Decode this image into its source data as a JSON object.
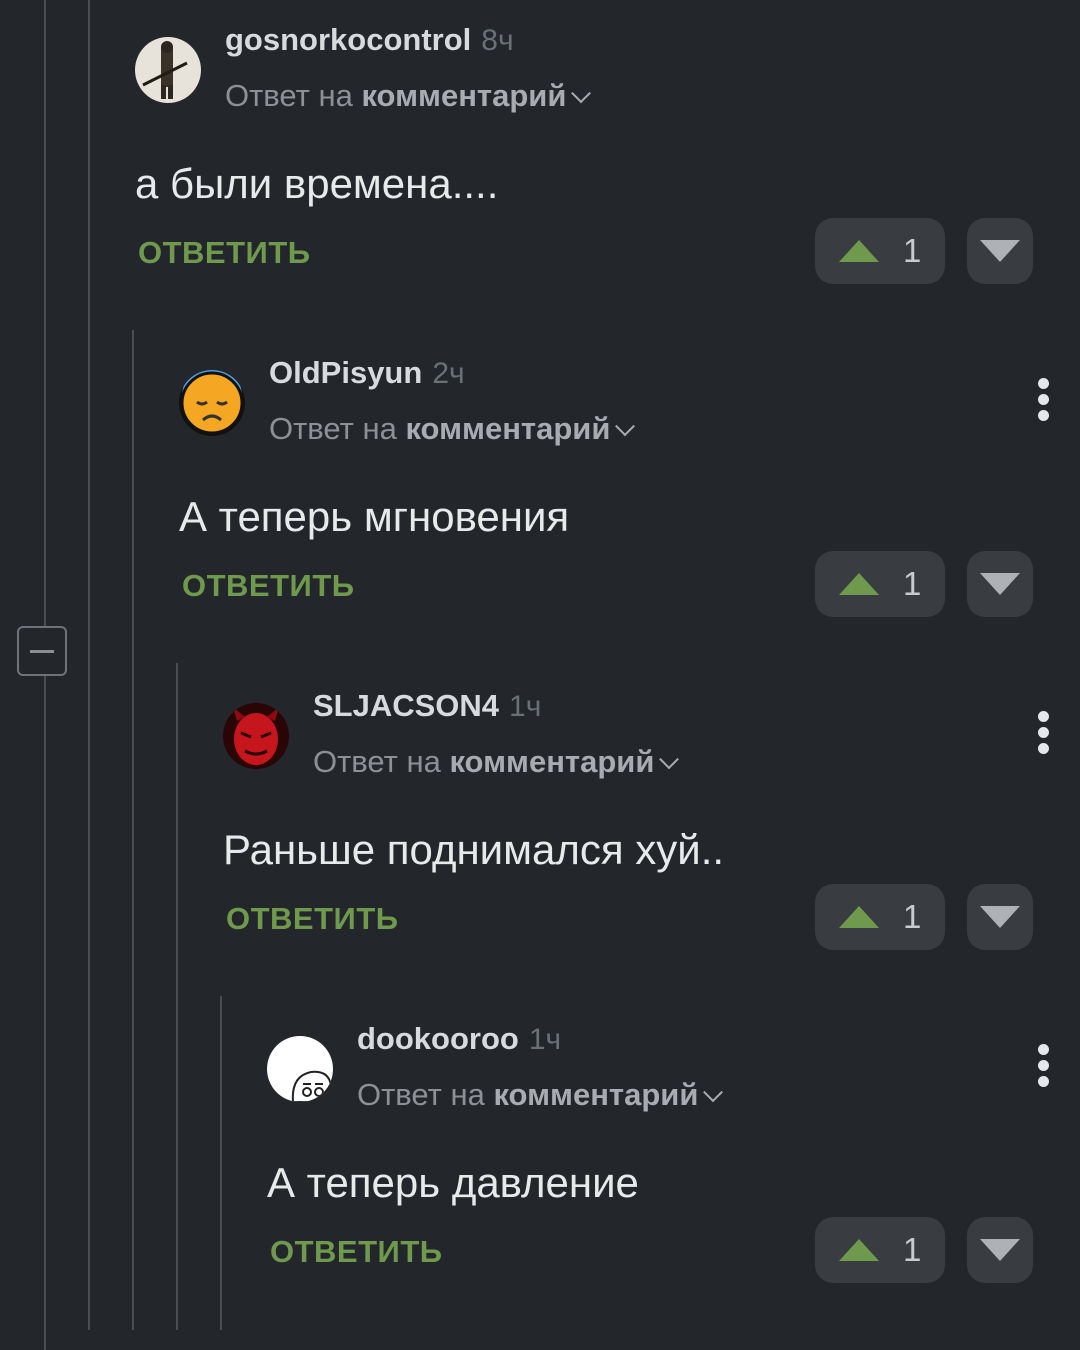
{
  "ui": {
    "reply_prefix": "Ответ на",
    "reply_target": "комментарий",
    "reply_button": "ОТВЕТИТЬ",
    "collapse_label": "collapse-thread"
  },
  "comments": [
    {
      "author": "gosnorkocontrol",
      "time": "8ч",
      "text": "а были времена....",
      "votes": "1",
      "avatar_icon": "soldier-avatar"
    },
    {
      "author": "OldPisyun",
      "time": "2ч",
      "text": "А теперь мгновения",
      "votes": "1",
      "avatar_icon": "sad-emoji-avatar"
    },
    {
      "author": "SLJACSON4",
      "time": "1ч",
      "text": "Раньше поднимался хуй..",
      "votes": "1",
      "avatar_icon": "red-devil-avatar"
    },
    {
      "author": "dookooroo",
      "time": "1ч",
      "text": "А теперь давление",
      "votes": "1",
      "avatar_icon": "cartoon-face-avatar"
    }
  ],
  "colors": {
    "background": "#23262b",
    "accent_green": "#6f9a4d",
    "button_bg": "#393c41"
  }
}
